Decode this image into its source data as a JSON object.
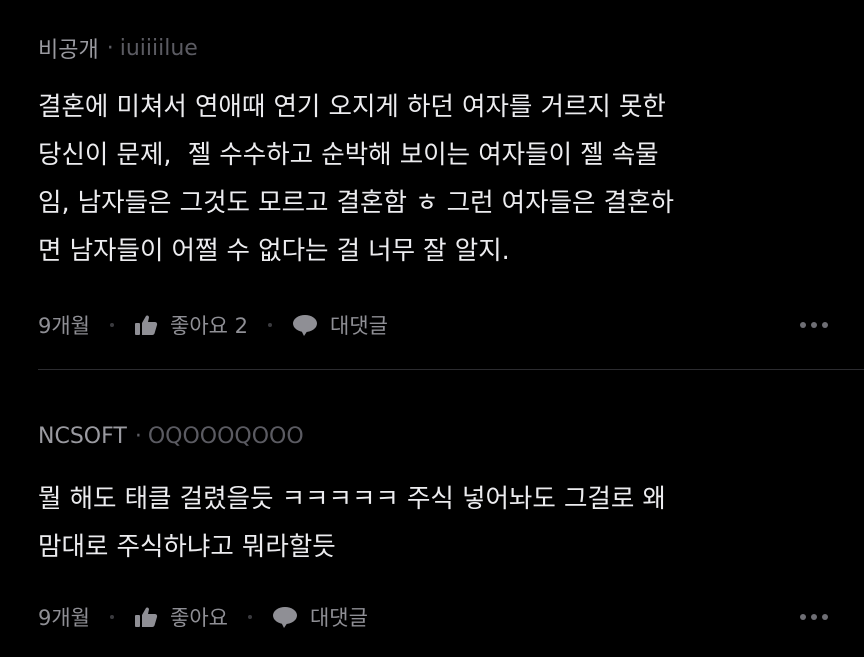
{
  "comments": [
    {
      "author": "비공개",
      "separator": "·",
      "handle": "iuiiiilue",
      "text": "결혼에 미쳐서 연애때 연기 오지게 하던 여자를 거르지 못한\n당신이 문제,  젤 수수하고 순박해 보이는 여자들이 젤 속물\n임, 남자들은 그것도 모르고 결혼함 ㅎ 그런 여자들은 결혼하\n면 남자들이 어쩔 수 없다는 걸 너무 잘 알지.",
      "time": "9개월",
      "like_label": "좋아요 2",
      "reply_label": "대댓글"
    },
    {
      "author": "NCSOFT",
      "separator": "·",
      "handle": "OQOOOQOOO",
      "text": "뭘 해도 태클 걸렸을듯 ㅋㅋㅋㅋㅋ 주식 넣어놔도 그걸로 왜\n맘대로 주식하냐고 뭐라할듯",
      "time": "9개월",
      "like_label": "좋아요",
      "reply_label": "대댓글"
    }
  ],
  "icons": {
    "like": "thumbs-up-icon",
    "reply": "speech-bubble-icon",
    "more": "more-dots-icon"
  },
  "colors": {
    "background": "#000000",
    "text": "#ececef",
    "muted": "#8f8f95",
    "divider": "#2c2c30"
  }
}
